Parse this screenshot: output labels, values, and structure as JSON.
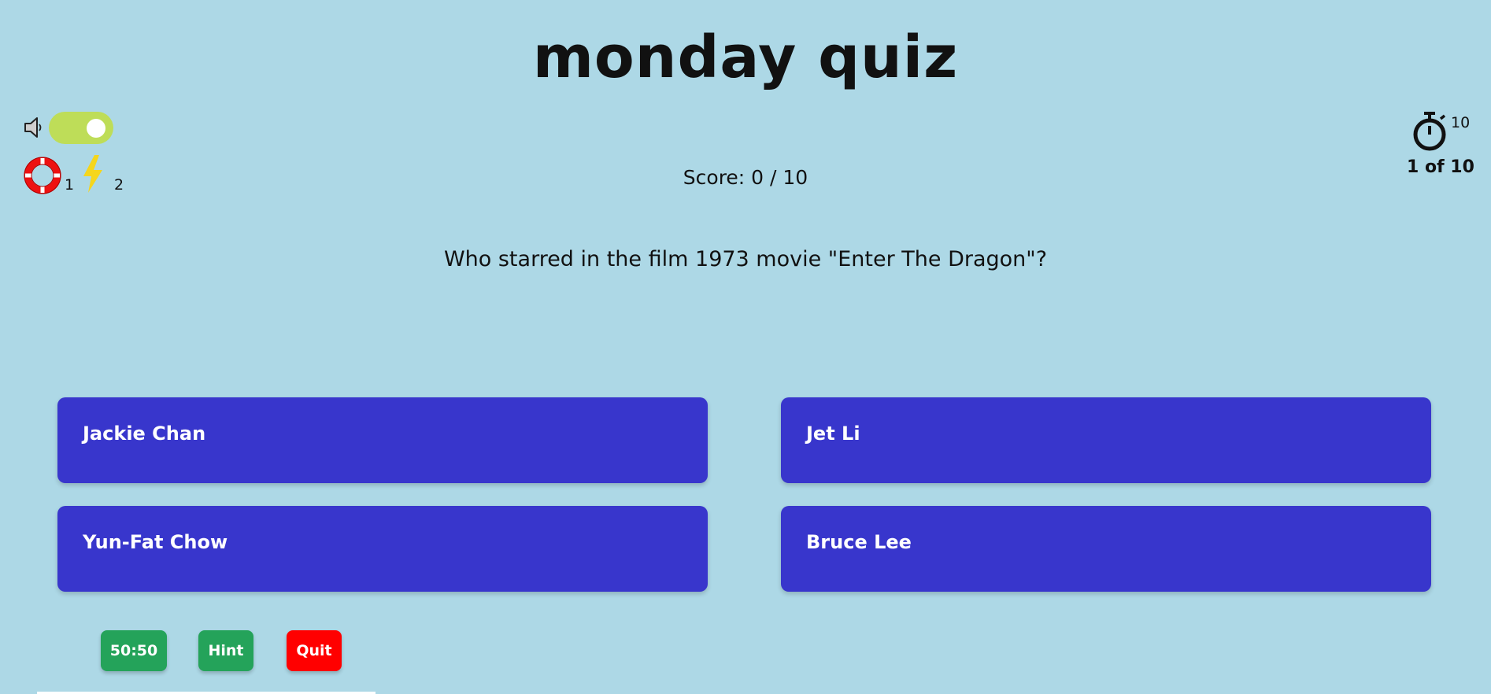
{
  "title": "monday quiz",
  "sound": {
    "icon": "speaker-icon",
    "enabled": true,
    "toggle_color": "#bedd58"
  },
  "lifelines": {
    "hints": {
      "icon": "lifebuoy-icon",
      "count": "1"
    },
    "fifty_fifty": {
      "icon": "lightning-bolt-icon",
      "count": "2"
    }
  },
  "score": {
    "text": "Score: 0 / 10"
  },
  "timer": {
    "icon": "stopwatch-icon",
    "value": "10"
  },
  "progress": {
    "text": "1 of 10"
  },
  "question": "Who starred in the film 1973 movie \"Enter The Dragon\"?",
  "options": [
    {
      "label": "Jackie Chan"
    },
    {
      "label": "Jet Li"
    },
    {
      "label": "Yun-Fat Chow"
    },
    {
      "label": "Bruce Lee"
    }
  ],
  "actions": {
    "fifty_fifty_label": "50:50",
    "hint_label": "Hint",
    "quit_label": "Quit"
  },
  "colors": {
    "background": "#add8e6",
    "option": "#3836cc",
    "action_green": "#24a35a",
    "quit_red": "#ff0000"
  }
}
